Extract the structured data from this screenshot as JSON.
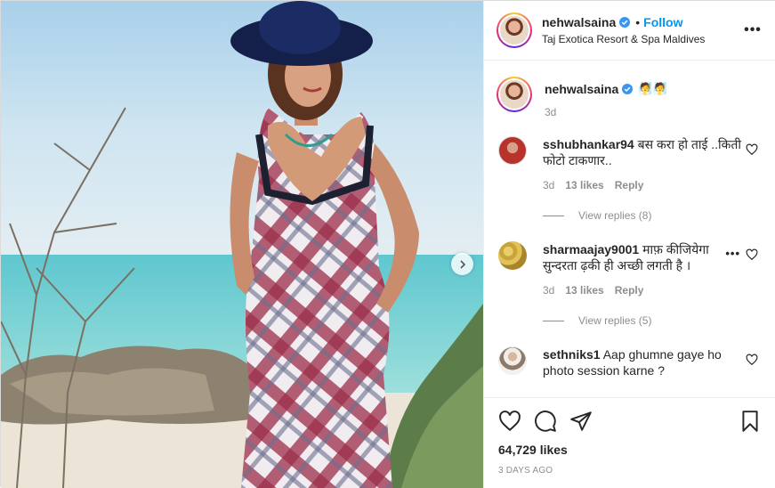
{
  "header": {
    "username": "nehwalsaina",
    "dot": "•",
    "follow_label": "Follow",
    "location": "Taj Exotica Resort & Spa Maldives",
    "more_label": "•••"
  },
  "caption": {
    "username": "nehwalsaina",
    "emojis": "🧖🧖",
    "time": "3d"
  },
  "comments": [
    {
      "username": "sshubhankar94",
      "text": "बस करा हो ताई ..किती फोटो टाकणार..",
      "time": "3d",
      "likes": "13 likes",
      "reply_label": "Reply",
      "view_replies": "View replies (8)",
      "avatar_color": "#b7332b"
    },
    {
      "username": "sharmaajay9001",
      "text": "माफ़ कीजियेगा सुन्दरता ढ़की ही अच्छी लगती है ।",
      "time": "3d",
      "likes": "13 likes",
      "reply_label": "Reply",
      "view_replies": "View replies (5)",
      "more_label": "•••",
      "avatar_color": "#c9a43a"
    },
    {
      "username": "sethniks1",
      "text": "Aap ghumne gaye ho photo session karne ?",
      "avatar_color": "#8c7b6a"
    }
  ],
  "footer": {
    "likes": "64,729 likes",
    "time_ago": "3 DAYS AGO"
  },
  "colors": {
    "follow_blue": "#0095f6",
    "verified_blue": "#3897f0",
    "muted_gray": "#8e8e8e",
    "text_dark": "#262626"
  },
  "icons": {
    "like": "heart-icon",
    "comment": "comment-bubble-icon",
    "share": "paper-plane-icon",
    "save": "bookmark-icon",
    "next": "chevron-right-icon"
  }
}
